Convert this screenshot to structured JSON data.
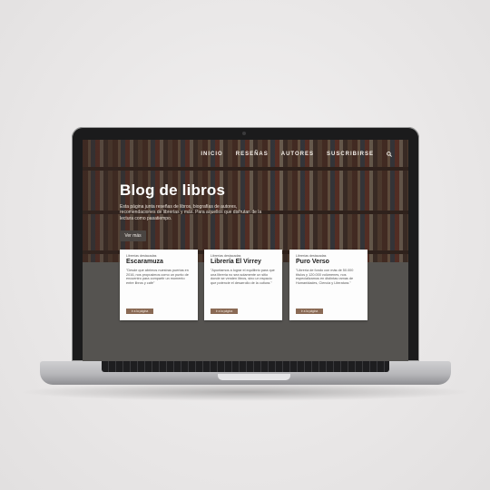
{
  "nav": {
    "items": [
      "INICIO",
      "RESEÑAS",
      "AUTORES",
      "SUSCRIBIRSE"
    ],
    "search_icon": "search-icon"
  },
  "hero": {
    "title": "Blog de libros",
    "intro": "Esta página junta reseñas de libros, biografías de autores, recomendaciones de librerías y más. Para aquellos que disfrutan de la lectura como pasatiempo.",
    "button": "Ver más"
  },
  "cards": [
    {
      "kicker": "Librerías destacadas",
      "name": "Escaramuza",
      "desc": "\"Desde que abrimos nuestras puertas en 2016, nos propusimos como un punto de encuentro para compartir un momento entre libros y café\"",
      "button": "Ir a la página"
    },
    {
      "kicker": "Librerías destacadas",
      "name": "Librería El Virrey",
      "desc": "\"Apuntamos a lograr el equilibrio para que una librería no sea solamente un sitio donde se venden libros, sino un espacio que potencie el desarrollo de la cultura.\"",
      "button": "Ir a la página"
    },
    {
      "kicker": "Librerías destacadas",
      "name": "Puro Verso",
      "desc": "\"Librería de fondo con más de 50.000 títulos y 120.000 volúmenes, nos especializamos en distintas ramas de Humanidades, Ciencia y Literatura.\"",
      "button": "Ir a la página"
    }
  ]
}
